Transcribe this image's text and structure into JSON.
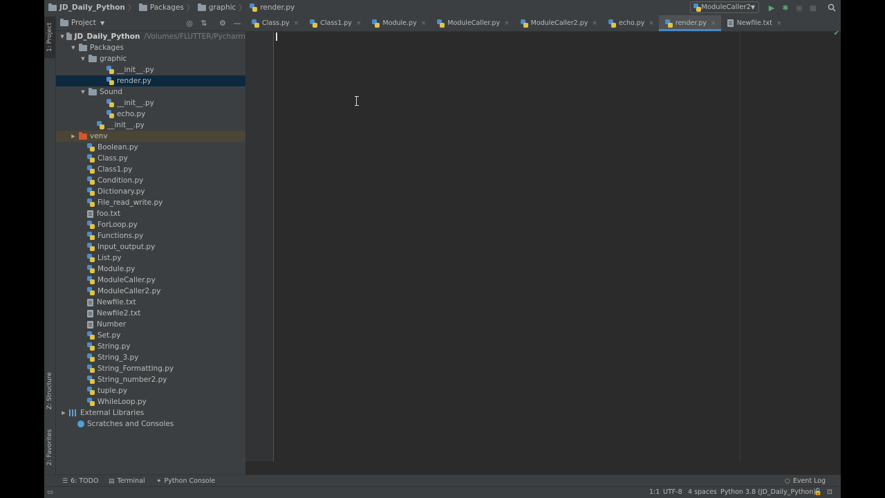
{
  "breadcrumb": {
    "items": [
      "JD_Daily_Python",
      "Packages",
      "graphic",
      "render.py"
    ]
  },
  "toolbar": {
    "run_config": "ModuleCaller2"
  },
  "left_strip": {
    "project_tab": "1: Project",
    "structure_tab": "Z: Structure",
    "favorites_tab": "2: Favorites"
  },
  "project_panel": {
    "title": "Project",
    "tree": [
      {
        "label": "JD_Daily_Python",
        "path": "/Volumes/FLUTTER/Pycharm",
        "kind": "root"
      },
      {
        "label": "Packages",
        "kind": "folder"
      },
      {
        "label": "graphic",
        "kind": "folder"
      },
      {
        "label": "__init__.py",
        "kind": "py"
      },
      {
        "label": "render.py",
        "kind": "py",
        "selected": true
      },
      {
        "label": "Sound",
        "kind": "folder"
      },
      {
        "label": "__init__.py",
        "kind": "py"
      },
      {
        "label": "echo.py",
        "kind": "py"
      },
      {
        "label": "__init__.py",
        "kind": "py"
      },
      {
        "label": "venv",
        "kind": "venv"
      },
      {
        "label": "Boolean.py",
        "kind": "py"
      },
      {
        "label": "Class.py",
        "kind": "py"
      },
      {
        "label": "Class1.py",
        "kind": "py"
      },
      {
        "label": "Condition.py",
        "kind": "py"
      },
      {
        "label": "Dictionary.py",
        "kind": "py"
      },
      {
        "label": "File_read_write.py",
        "kind": "py"
      },
      {
        "label": "foo.txt",
        "kind": "txt"
      },
      {
        "label": "ForLoop.py",
        "kind": "py"
      },
      {
        "label": "Functions.py",
        "kind": "py"
      },
      {
        "label": "Input_output.py",
        "kind": "py"
      },
      {
        "label": "List.py",
        "kind": "py"
      },
      {
        "label": "Module.py",
        "kind": "py"
      },
      {
        "label": "ModuleCaller.py",
        "kind": "py"
      },
      {
        "label": "ModuleCaller2.py",
        "kind": "py"
      },
      {
        "label": "Newfile.txt",
        "kind": "txt"
      },
      {
        "label": "Newfile2.txt",
        "kind": "txt"
      },
      {
        "label": "Number",
        "kind": "txt"
      },
      {
        "label": "Set.py",
        "kind": "py"
      },
      {
        "label": "String.py",
        "kind": "py"
      },
      {
        "label": "String_3.py",
        "kind": "py"
      },
      {
        "label": "String_Formatting.py",
        "kind": "py"
      },
      {
        "label": "String_number2.py",
        "kind": "py"
      },
      {
        "label": "tuple.py",
        "kind": "py"
      },
      {
        "label": "WhileLoop.py",
        "kind": "py"
      },
      {
        "label": "External Libraries",
        "kind": "lib"
      },
      {
        "label": "Scratches and Consoles",
        "kind": "scratch"
      }
    ]
  },
  "editor_tabs": [
    {
      "label": "Class.py",
      "kind": "py"
    },
    {
      "label": "Class1.py",
      "kind": "py"
    },
    {
      "label": "Module.py",
      "kind": "py"
    },
    {
      "label": "ModuleCaller.py",
      "kind": "py"
    },
    {
      "label": "ModuleCaller2.py",
      "kind": "py"
    },
    {
      "label": "echo.py",
      "kind": "py"
    },
    {
      "label": "render.py",
      "kind": "py",
      "active": true
    },
    {
      "label": "Newfile.txt",
      "kind": "txt"
    }
  ],
  "bottom_tool_windows": {
    "todo": "6: TODO",
    "terminal": "Terminal",
    "python_console": "Python Console",
    "event_log": "Event Log"
  },
  "status_bar": {
    "position": "1:1",
    "encoding": "UTF-8",
    "indent": "4 spaces",
    "interpreter": "Python 3.8 (JD_Daily_Python)"
  },
  "colors": {
    "selection": "#0d293e",
    "venv_highlight": "#4a4535",
    "active_tab_underline": "#4a88c7",
    "run_green": "#59a869"
  }
}
